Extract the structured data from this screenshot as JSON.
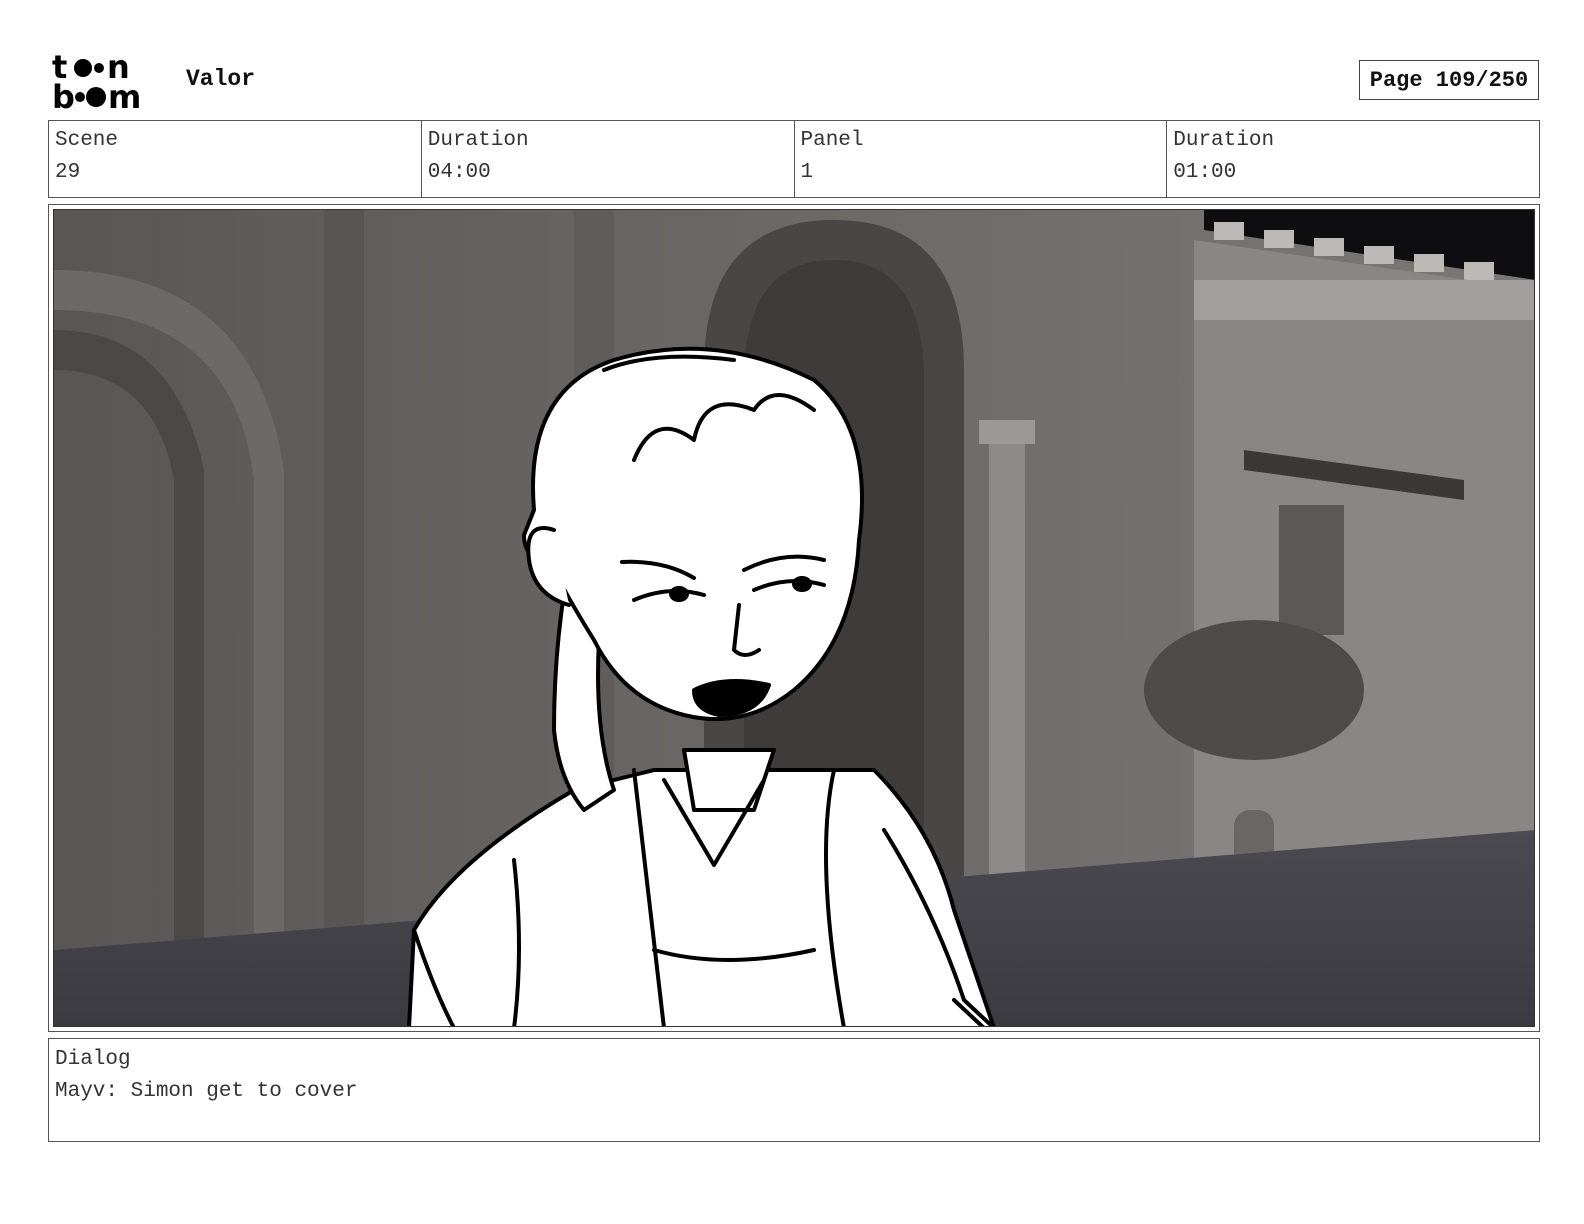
{
  "header": {
    "logo_text": [
      "t",
      "n",
      "b",
      "m"
    ],
    "project_title": "Valor",
    "page_label": "Page 109/250"
  },
  "info": {
    "scene_label": "Scene",
    "scene_value": "29",
    "scene_duration_label": "Duration",
    "scene_duration_value": "04:00",
    "panel_label": "Panel",
    "panel_value": "1",
    "panel_duration_label": "Duration",
    "panel_duration_value": "01:00"
  },
  "dialog": {
    "label": "Dialog",
    "text": "Mayv: Simon get to cover"
  }
}
